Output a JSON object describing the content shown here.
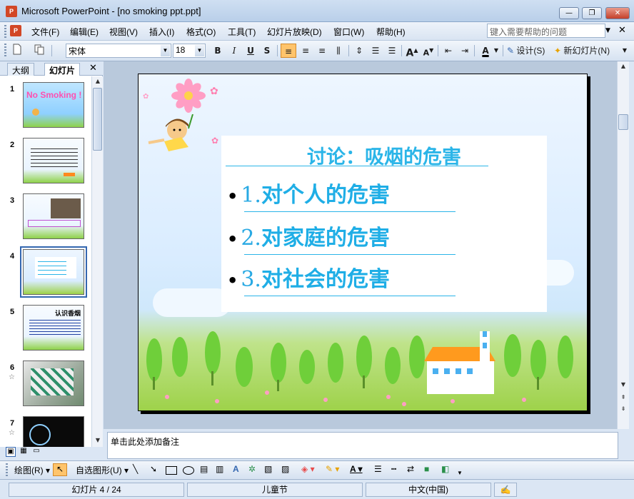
{
  "window": {
    "title": "Microsoft PowerPoint - [no smoking ppt.ppt]",
    "app_icon_text": "P",
    "minimize_label": "—",
    "maximize_label": "❐",
    "close_label": "✕"
  },
  "menu": {
    "items": [
      "文件(F)",
      "编辑(E)",
      "视图(V)",
      "插入(I)",
      "格式(O)",
      "工具(T)",
      "幻灯片放映(D)",
      "窗口(W)",
      "帮助(H)"
    ],
    "help_placeholder": "键入需要帮助的问题"
  },
  "toolbar": {
    "font_name": "宋体",
    "font_size": "18",
    "bold": "B",
    "italic": "I",
    "underline": "U",
    "shadow": "S",
    "design_label": "设计(S)",
    "new_slide_label": "新幻灯片(N)",
    "font_color_label": "A",
    "grow_font": "A",
    "shrink_font": "A"
  },
  "left_panel": {
    "tabs": [
      "大纲",
      "幻灯片"
    ],
    "close_label": "✕",
    "selected_slide": 4,
    "thumbnails": [
      {
        "number": "1",
        "caption": "No Smoking !"
      },
      {
        "number": "2",
        "caption": ""
      },
      {
        "number": "3",
        "caption": ""
      },
      {
        "number": "4",
        "caption": ""
      },
      {
        "number": "5",
        "caption": "认识香烟"
      },
      {
        "number": "6",
        "caption": ""
      },
      {
        "number": "7",
        "caption": ""
      }
    ]
  },
  "slide": {
    "title": "讨论：吸烟的危害",
    "bullets": [
      {
        "num": "1.",
        "text": "对个人的危害"
      },
      {
        "num": "2.",
        "text": "对家庭的危害"
      },
      {
        "num": "3.",
        "text": "对社会的危害"
      }
    ]
  },
  "notes": {
    "placeholder": "单击此处添加备注"
  },
  "drawbar": {
    "draw_label": "绘图(R)",
    "autoshapes_label": "自选图形(U)"
  },
  "status": {
    "slide_info": "幻灯片 4 / 24",
    "design_name": "儿童节",
    "language": "中文(中国)"
  },
  "colors": {
    "accent": "#2bb5e8",
    "title_bar": "#cfdff2",
    "active_button": "#ffc46b"
  }
}
